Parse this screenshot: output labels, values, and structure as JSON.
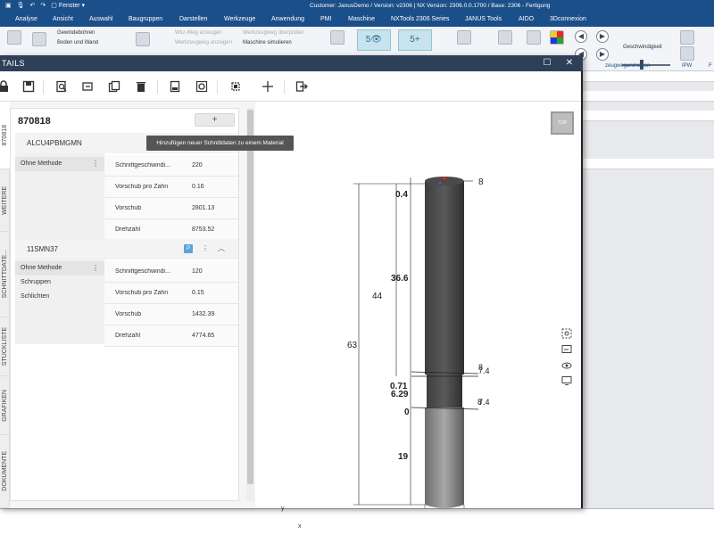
{
  "nx": {
    "window_label": "Fenster",
    "caption": "Customer: JanusDemo / Version: v2306 | NX Version: 2306.0.0.1700 / Base: 2306 - Fertigung",
    "menu": [
      "Analyse",
      "Ansicht",
      "Auswahl",
      "Baugruppen",
      "Darstellen",
      "Werkzeuge",
      "Anwendung",
      "PMI",
      "Maschine",
      "NXTools 2306 Series",
      "JANUS Tools",
      "AIDO",
      "3Dconnexion"
    ],
    "ribbon": {
      "gewinde": "Gewindebohren",
      "boden": "Boden und Wand",
      "wkz_weg": "Wkz-Weg erzeugen",
      "wkz_pruefen": "Werkzeugweg überprüfen",
      "wkz_anzeigen": "Werkzeugweg anzeigen",
      "maschine_sim": "Maschine simulieren",
      "geschwindigkeit": "Geschwindigkeit",
      "animation": "zeugweganimation",
      "ipw": "IPW",
      "f": "F"
    }
  },
  "dialog": {
    "title": "TAILS",
    "maximize": "☐",
    "close": "✕"
  },
  "vtabs": [
    "870818",
    "WEITERE",
    "SCHNITTDATE...",
    "STÜCKLISTE",
    "GRAFIKEN",
    "DOKUMENTE"
  ],
  "panel": {
    "title": "870818",
    "add_label": "+",
    "tooltip": "Hinzufügen neuer Schnittdaten zu einem Material",
    "materials": [
      {
        "name": "ALCU4PBMGMN",
        "methods": [
          "Ohne Methode"
        ],
        "params": [
          {
            "label": "Schnittgeschwindi...",
            "value": "220"
          },
          {
            "label": "Vorschub pro Zahn",
            "value": "0.16"
          },
          {
            "label": "Vorschub",
            "value": "2801.13"
          },
          {
            "label": "Drehzahl",
            "value": "8753.52"
          }
        ]
      },
      {
        "name": "11SMN37",
        "badge": "P",
        "methods": [
          "Ohne Methode",
          "Schruppen",
          "Schlichten"
        ],
        "params": [
          {
            "label": "Schnittgeschwindi...",
            "value": "120"
          },
          {
            "label": "Vorschub pro Zahn",
            "value": "0.15"
          },
          {
            "label": "Vorschub",
            "value": "1432.39"
          },
          {
            "label": "Drehzahl",
            "value": "4774.65"
          }
        ]
      }
    ]
  },
  "drawing": {
    "view_cube": "TOP",
    "dims": {
      "d_top": "8",
      "d_bottom": "8",
      "h_total": "63",
      "h_44": "44",
      "h_36": "36.6",
      "h_04": "0.4",
      "h_071": "0.71",
      "h_629": "6.29",
      "h_0": "0",
      "h_19": "19",
      "r_74": "7.4",
      "r_8": "8",
      "r_74b": "7.4",
      "r_8b": "8"
    },
    "axes": {
      "x": "x",
      "y": "y"
    }
  }
}
